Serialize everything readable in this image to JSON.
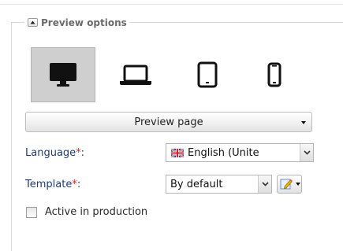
{
  "panel": {
    "legend": "Preview options"
  },
  "devices": [
    {
      "name": "Desktop",
      "icon": "desktop-monitor-icon",
      "selected": true
    },
    {
      "name": "Laptop",
      "icon": "laptop-icon",
      "selected": false
    },
    {
      "name": "Tablet",
      "icon": "tablet-icon",
      "selected": false
    },
    {
      "name": "Phone",
      "icon": "smartphone-icon",
      "selected": false
    }
  ],
  "preview_button": {
    "label": "Preview page"
  },
  "language": {
    "label": "Language",
    "required_mark": "*",
    "colon": ":",
    "value": "English (Unite",
    "flag_icon": "uk-flag-icon"
  },
  "template": {
    "label": "Template",
    "required_mark": "*",
    "colon": ":",
    "value": "By default",
    "edit_icon": "edit-pencil-icon"
  },
  "active_in_production": {
    "label": "Active in production",
    "checked": false
  },
  "colors": {
    "label_blue": "#1d3c78",
    "required_red": "#e02020",
    "selected_device_bg": "#cfcfcf"
  }
}
